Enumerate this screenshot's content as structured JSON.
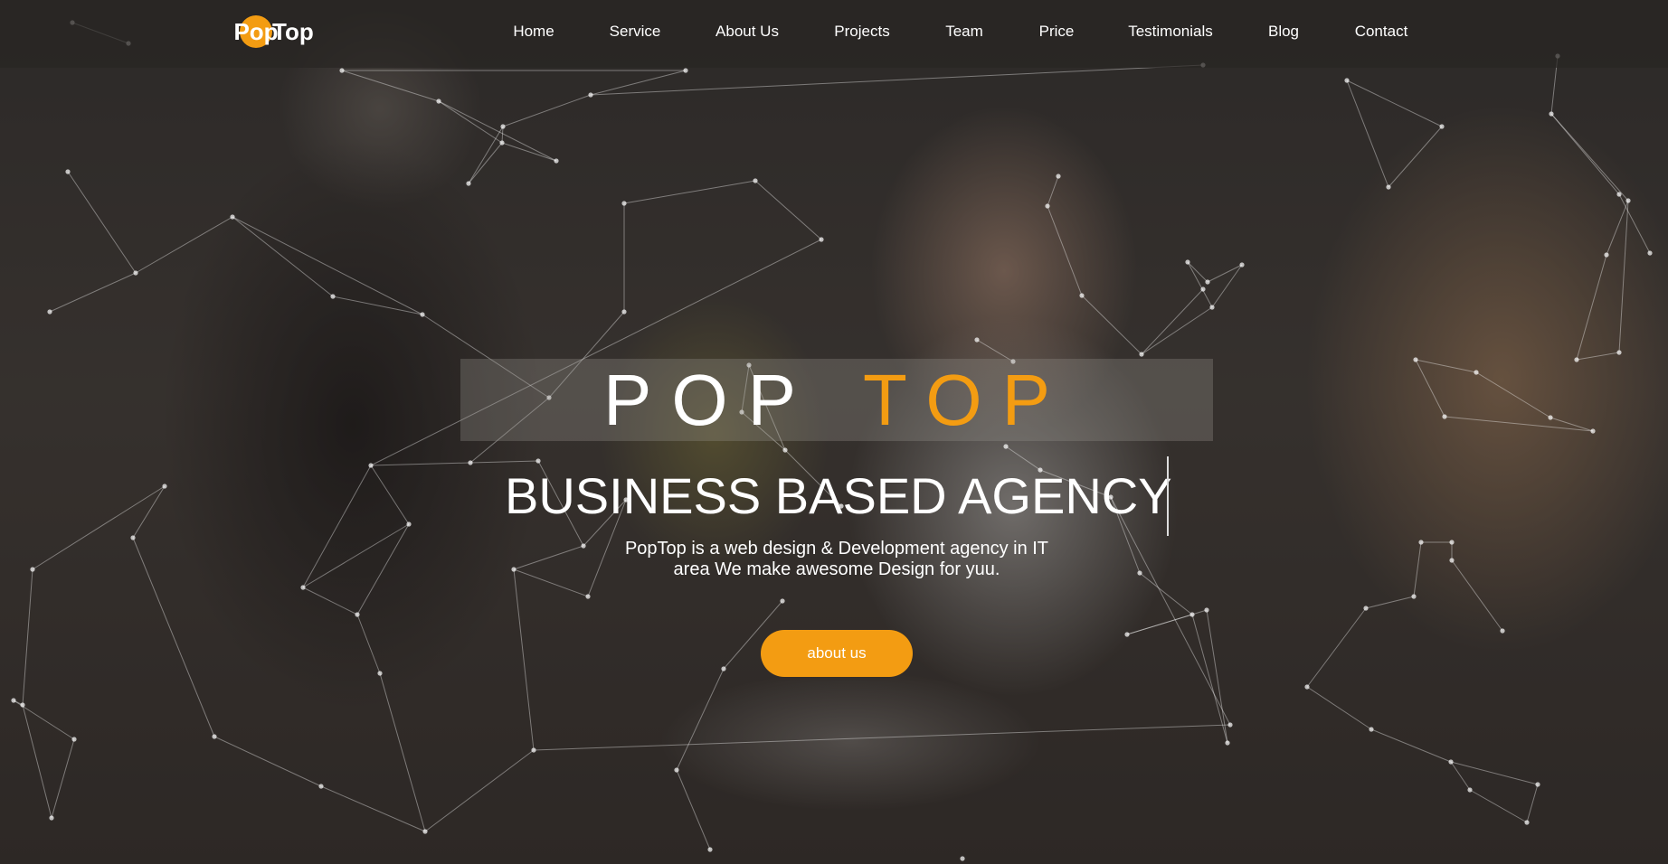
{
  "brand": {
    "logo_pop": "Pop",
    "logo_top": "Top",
    "accent_color": "#f39c12"
  },
  "nav": {
    "items": [
      {
        "label": "Home"
      },
      {
        "label": "Service"
      },
      {
        "label": "About Us"
      },
      {
        "label": "Projects"
      },
      {
        "label": "Team"
      },
      {
        "label": "Price"
      },
      {
        "label": "Testimonials"
      },
      {
        "label": "Blog"
      },
      {
        "label": "Contact"
      }
    ]
  },
  "hero": {
    "title_part1": "POP",
    "title_part2": "TOP",
    "subtitle": "BUSINESS BASED AGENCY",
    "description_line1": "PopTop is a web design & Development agency in IT",
    "description_line2": "area We make awesome Design for yuu.",
    "button_label": "about us",
    "background_image": "four young women smiling and studying at a table",
    "background_overlay": "particle network lines"
  }
}
